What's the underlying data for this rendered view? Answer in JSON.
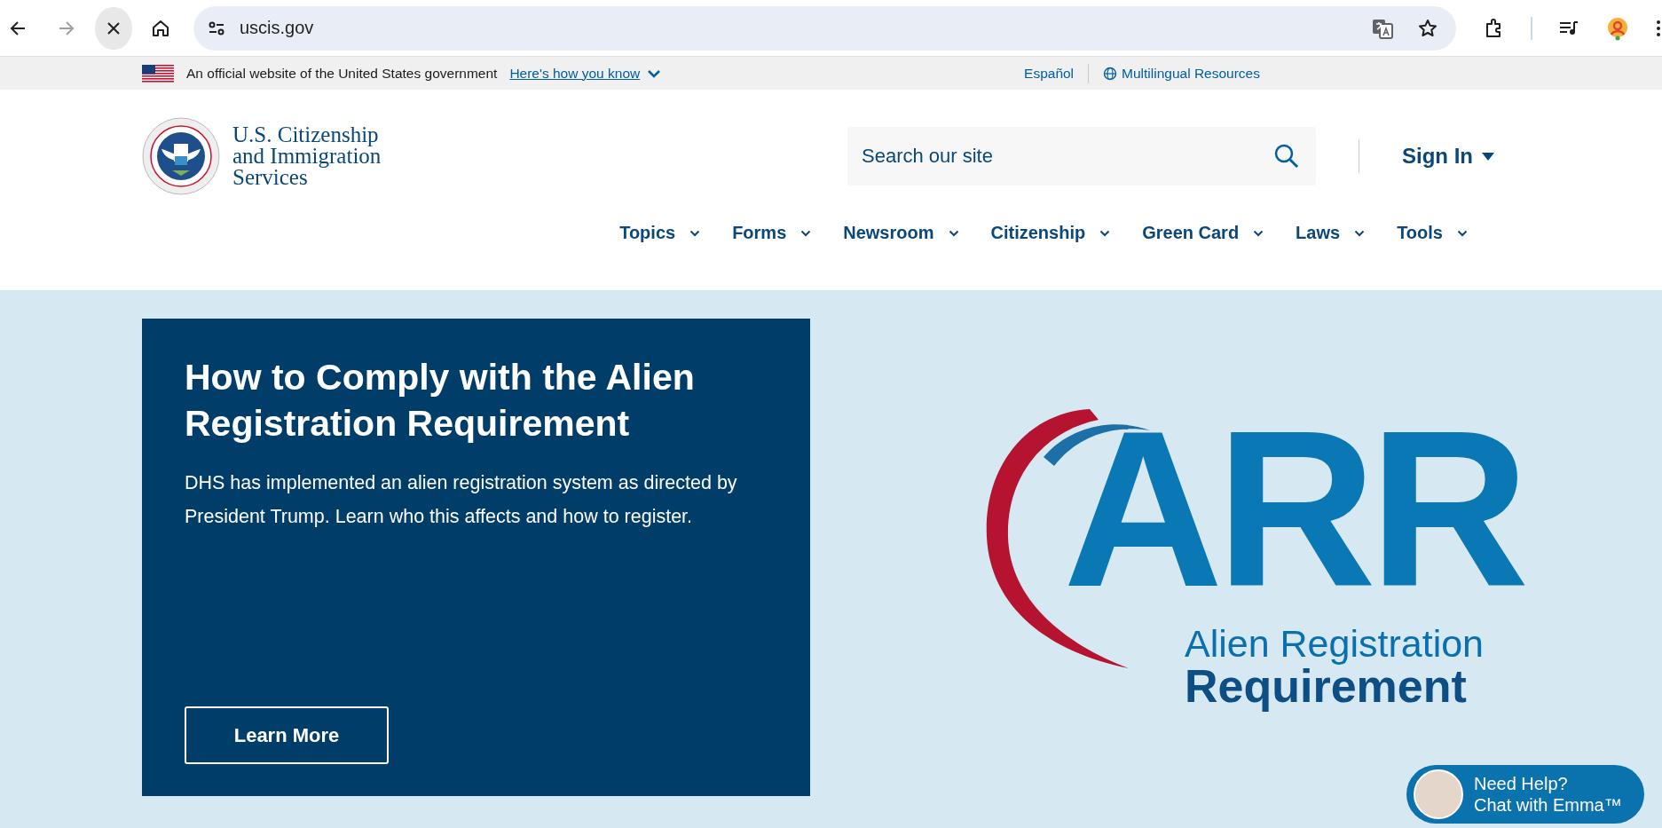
{
  "browser": {
    "nav_buttons": [
      {
        "kind": "back",
        "disabled": false
      },
      {
        "kind": "forward",
        "disabled": true
      },
      {
        "kind": "stop",
        "disabled": false
      },
      {
        "kind": "home",
        "disabled": false
      }
    ],
    "url": "uscis.gov"
  },
  "gov_banner": {
    "text": "An official website of the United States government",
    "link": "Here's how you know",
    "language_link": "Español",
    "resources_link": "Multilingual Resources"
  },
  "header": {
    "agency_name": [
      "U.S. Citizenship",
      "and Immigration",
      "Services"
    ],
    "search": {
      "placeholder": "Search our site"
    },
    "sign_in": "Sign In",
    "nav": [
      "Topics",
      "Forms",
      "Newsroom",
      "Citizenship",
      "Green Card",
      "Laws",
      "Tools"
    ]
  },
  "hero": {
    "title": "How to Comply with the Alien Registration Requirement",
    "description": "DHS has implemented an alien registration system as directed by President Trump. Learn who this affects and how to register.",
    "button": "Learn More",
    "logo": {
      "acronym": "ARR",
      "line_1": "Alien Registration",
      "line_2": "Requirement"
    }
  },
  "chat": {
    "line_1": "Need Help?",
    "line_2": "Chat with Emma™"
  }
}
